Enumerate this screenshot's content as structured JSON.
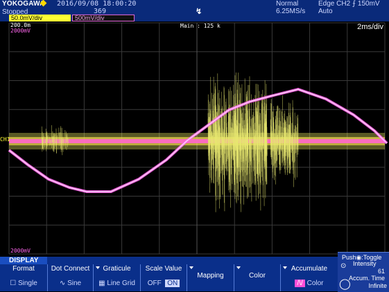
{
  "header": {
    "brand": "YOKOGAWA",
    "run_state": "Stopped",
    "date_time": "2016/09/08  18:00:20",
    "record_count": "369",
    "trigger_pos_marker": "↯",
    "acq_mode": "Normal",
    "sample_rate": "6.25MS/s",
    "trigger": "Edge CH2 ⨍ 150mV",
    "trigger_mode": "Auto",
    "ch1_scale": "50.0mV/div",
    "ch2_scale": "500mV/div"
  },
  "screen": {
    "ch1_top_value": "200.0m",
    "ch2_top_value": "2000mV",
    "ch2_bottom_value": "2000mV",
    "main_length": "Main : 125 k",
    "time_per_div": "2ms/div",
    "ch1_marker": "CH1"
  },
  "softkeys": {
    "menu_title": "DISPLAY",
    "keys": [
      {
        "label": "Format",
        "value": "Single",
        "has_arrow": false
      },
      {
        "label": "Dot Connect",
        "value": "Sine",
        "has_arrow": false
      },
      {
        "label": "Graticule",
        "value": "Line Grid",
        "has_arrow": true
      },
      {
        "label": "Scale Value",
        "value_off": "OFF",
        "value_on": "ON",
        "has_arrow": true
      },
      {
        "label": "Mapping",
        "value": "",
        "has_arrow": true
      },
      {
        "label": "Color",
        "value": "",
        "has_arrow": true
      },
      {
        "label": "Accumulate",
        "value": "Color",
        "has_arrow": true
      }
    ]
  },
  "knob_panel": {
    "push_label": "Push",
    "toggle_label": "Toggle",
    "intensity_label": "Intensity",
    "intensity_value": "61",
    "accum_label": "Accum. Time",
    "accum_value": "Infinite"
  },
  "colors": {
    "ch1": "#ffff33",
    "ch2": "#ff66ee",
    "bar_blue": "#0a2f8a",
    "grid": "#3a3a3a"
  }
}
